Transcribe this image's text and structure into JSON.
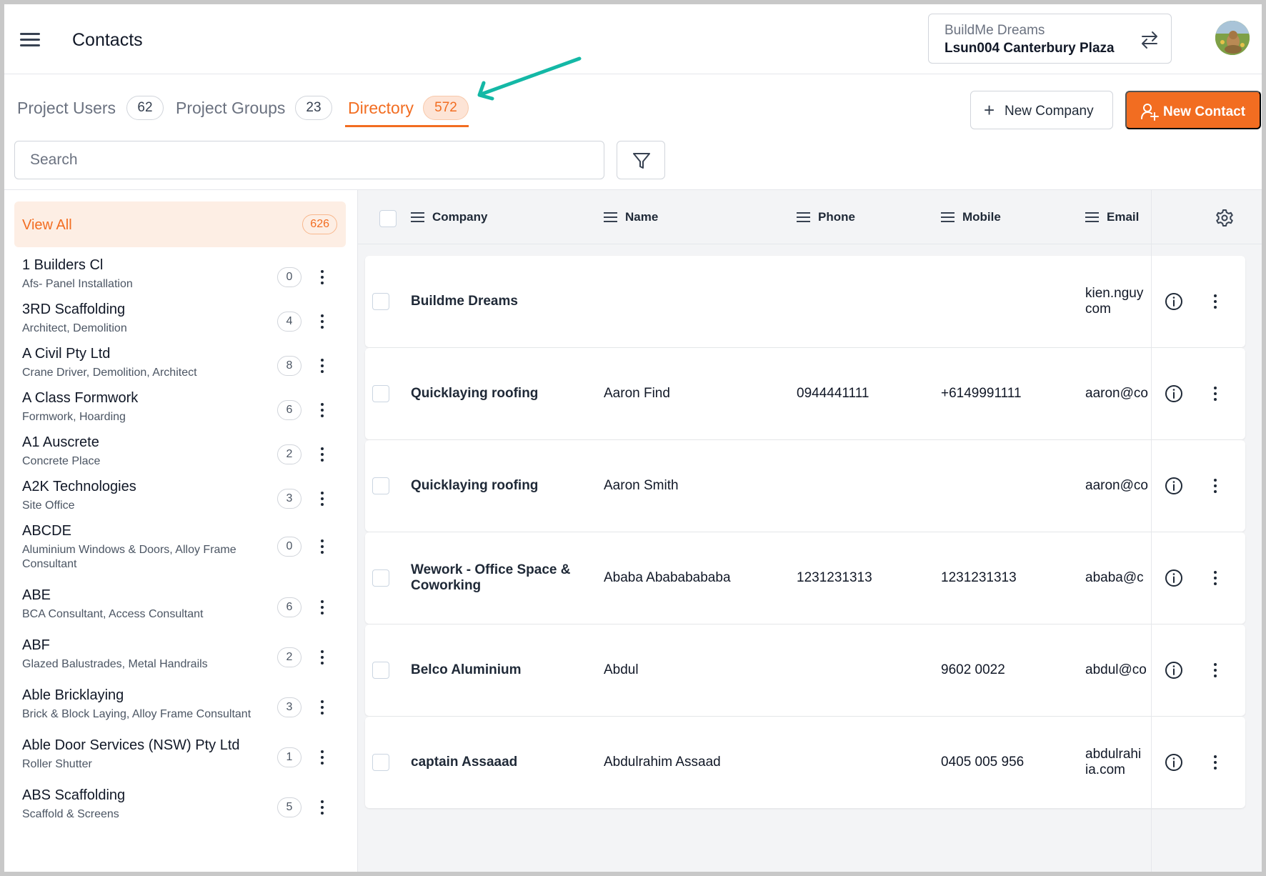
{
  "header": {
    "title": "Contacts",
    "project_org": "BuildMe Dreams",
    "project_name": "Lsun004 Canterbury Plaza"
  },
  "tabs": [
    {
      "label": "Project Users",
      "count": "62"
    },
    {
      "label": "Project Groups",
      "count": "23"
    },
    {
      "label": "Directory",
      "count": "572"
    }
  ],
  "actions": {
    "new_company": "New Company",
    "new_contact": "New Contact"
  },
  "search": {
    "placeholder": "Search"
  },
  "sidebar": {
    "view_all_label": "View All",
    "view_all_count": "626",
    "companies": [
      {
        "name": "1 Builders Cl",
        "trades": "Afs- Panel Installation",
        "count": "0"
      },
      {
        "name": "3RD Scaffolding",
        "trades": "Architect, Demolition",
        "count": "4"
      },
      {
        "name": "A Civil Pty Ltd",
        "trades": "Crane Driver, Demolition, Architect",
        "count": "8"
      },
      {
        "name": "A Class Formwork",
        "trades": "Formwork, Hoarding",
        "count": "6"
      },
      {
        "name": "A1 Auscrete",
        "trades": "Concrete Place",
        "count": "2"
      },
      {
        "name": "A2K Technologies",
        "trades": "Site Office",
        "count": "3"
      },
      {
        "name": "ABCDE",
        "trades": "Aluminium Windows & Doors, Alloy Frame Consultant",
        "count": "0"
      },
      {
        "name": "ABE",
        "trades": "BCA Consultant, Access Consultant",
        "count": "6"
      },
      {
        "name": "ABF",
        "trades": "Glazed Balustrades, Metal Handrails",
        "count": "2"
      },
      {
        "name": "Able Bricklaying",
        "trades": "Brick & Block Laying, Alloy Frame Consultant",
        "count": "3"
      },
      {
        "name": "Able Door Services (NSW) Pty Ltd",
        "trades": "Roller Shutter",
        "count": "1"
      },
      {
        "name": "ABS Scaffolding",
        "trades": "Scaffold & Screens",
        "count": "5"
      }
    ]
  },
  "table": {
    "columns": [
      "Company",
      "Name",
      "Phone",
      "Mobile",
      "Email"
    ],
    "rows": [
      {
        "company": "Buildme Dreams",
        "name": "",
        "phone": "",
        "mobile": "",
        "email": "kien.nguy\ncom"
      },
      {
        "company": "Quicklaying roofing",
        "name": "Aaron Find",
        "phone": "0944441111",
        "mobile": "+6149991111",
        "email": "aaron@co"
      },
      {
        "company": "Quicklaying roofing",
        "name": "Aaron Smith",
        "phone": "",
        "mobile": "",
        "email": "aaron@co"
      },
      {
        "company": "Wework - Office Space & Coworking",
        "name": "Ababa Abababababa",
        "phone": "1231231313",
        "mobile": "1231231313",
        "email": "ababa@c"
      },
      {
        "company": "Belco Aluminium",
        "name": "Abdul",
        "phone": "",
        "mobile": "9602 0022",
        "email": "abdul@co"
      },
      {
        "company": "captain Assaaad",
        "name": "Abdulrahim Assaad",
        "phone": "",
        "mobile": "0405 005 956",
        "email": "abdulrahi\nia.com"
      }
    ]
  },
  "colors": {
    "accent": "#f26d21",
    "annotation_arrow": "#14b8a6"
  }
}
